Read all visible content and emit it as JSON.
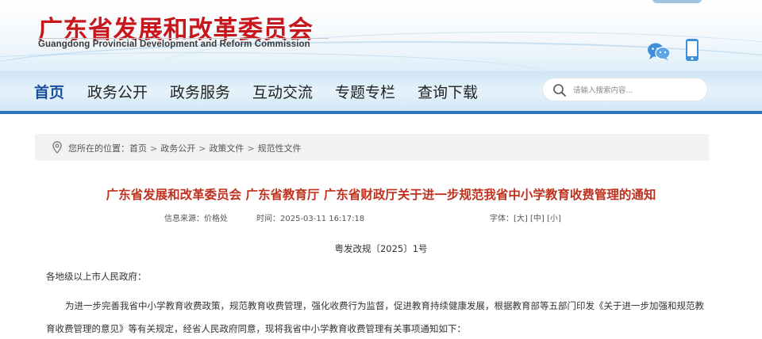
{
  "header": {
    "top_links": "",
    "title_cn": "广东省发展和改革委员会",
    "title_en": "Guangdong Provincial Development and Reform Commission"
  },
  "nav": {
    "items": [
      {
        "label": "首页"
      },
      {
        "label": "政务公开"
      },
      {
        "label": "政务服务"
      },
      {
        "label": "互动交流"
      },
      {
        "label": "专题专栏"
      },
      {
        "label": "查询下载"
      }
    ],
    "search_placeholder": "请输入搜索内容..."
  },
  "breadcrumb": {
    "prefix": "您所在的位置：",
    "items": [
      "首页",
      "政务公开",
      "政策文件",
      "规范性文件"
    ],
    "separator": ">"
  },
  "article": {
    "title": "广东省发展和改革委员会 广东省教育厅 广东省财政厅关于进一步规范我省中小学教育收费管理的通知",
    "source_label": "信息来源：",
    "source": "价格处",
    "time_label": "时间：",
    "time": "2025-03-11 16:17:18",
    "font_label": "字体：",
    "font_sizes": [
      "[大]",
      "[中]",
      "[小]"
    ],
    "doc_number": "粤发改规〔2025〕1号",
    "salutation": "各地级以上市人民政府：",
    "paragraph": "为进一步完善我省中小学教育收费政策，规范教育收费管理，强化收费行为监督，促进教育持续健康发展，根据教育部等五部门印发《关于进一步加强和规范教育收费管理的意见》等有关规定，经省人民政府同意，现将我省中小学教育收费管理有关事项通知如下："
  },
  "colors": {
    "brand_red": "#c8161d",
    "title_red": "#c0301e",
    "nav_blue": "#2f73b9",
    "active_nav": "#1a4f9c"
  }
}
